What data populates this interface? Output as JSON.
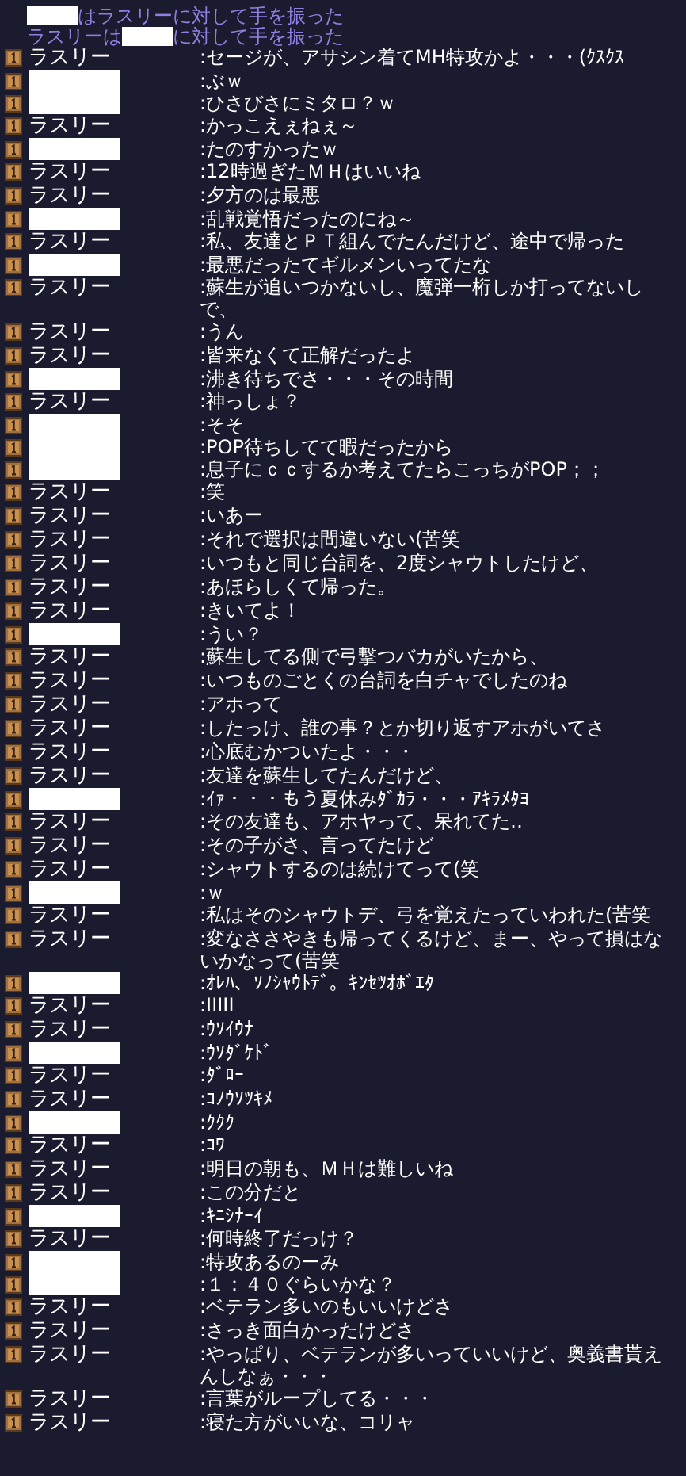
{
  "system_lines": [
    {
      "parts": [
        {
          "kind": "hidden"
        },
        {
          "kind": "text",
          "text": "はラスリーに対して手を振った"
        }
      ]
    },
    {
      "parts": [
        {
          "kind": "text",
          "text": "ラスリーは"
        },
        {
          "kind": "hidden"
        },
        {
          "kind": "text",
          "text": "に対して手を振った"
        }
      ]
    }
  ],
  "messages": [
    {
      "name_hidden": false,
      "name": "ラスリー",
      "text": ":セージが、アサシン着てMH特攻かよ・・・(ｸｽｸｽ"
    },
    {
      "name_hidden": true,
      "text": ":ぶｗ"
    },
    {
      "name_hidden": true,
      "text": ":ひさびさにミタロ？ｗ"
    },
    {
      "name_hidden": false,
      "name": "ラスリー",
      "text": ":かっこえぇねぇ～"
    },
    {
      "name_hidden": true,
      "text": ":たのすかったｗ"
    },
    {
      "name_hidden": false,
      "name": "ラスリー",
      "text": ":12時過ぎたＭＨはいいね"
    },
    {
      "name_hidden": false,
      "name": "ラスリー",
      "text": ":夕方のは最悪"
    },
    {
      "name_hidden": true,
      "text": ":乱戦覚悟だったのにね～"
    },
    {
      "name_hidden": false,
      "name": "ラスリー",
      "text": ":私、友達とＰＴ組んでたんだけど、途中で帰った"
    },
    {
      "name_hidden": true,
      "text": ":最悪だったてギルメンいってたな"
    },
    {
      "name_hidden": false,
      "name": "ラスリー",
      "text": ":蘇生が追いつかないし、魔弾一桁しか打ってないしで、"
    },
    {
      "name_hidden": false,
      "name": "ラスリー",
      "text": ":うん"
    },
    {
      "name_hidden": false,
      "name": "ラスリー",
      "text": ":皆来なくて正解だったよ"
    },
    {
      "name_hidden": true,
      "text": ":沸き待ちでさ・・・その時間"
    },
    {
      "name_hidden": false,
      "name": "ラスリー",
      "text": ":神っしょ？"
    },
    {
      "name_hidden": true,
      "text": ":そそ"
    },
    {
      "name_hidden": true,
      "text": ":POP待ちしてて暇だったから"
    },
    {
      "name_hidden": true,
      "text": ":息子にｃｃするか考えてたらこっちがPOP；；"
    },
    {
      "name_hidden": false,
      "name": "ラスリー",
      "text": ":笑"
    },
    {
      "name_hidden": false,
      "name": "ラスリー",
      "text": ":いあー"
    },
    {
      "name_hidden": false,
      "name": "ラスリー",
      "text": ":それで選択は間違いない(苦笑"
    },
    {
      "name_hidden": false,
      "name": "ラスリー",
      "text": ":いつもと同じ台詞を、2度シャウトしたけど、"
    },
    {
      "name_hidden": false,
      "name": "ラスリー",
      "text": ":あほらしくて帰った。"
    },
    {
      "name_hidden": false,
      "name": "ラスリー",
      "text": ":きいてよ！"
    },
    {
      "name_hidden": true,
      "text": ":うい？"
    },
    {
      "name_hidden": false,
      "name": "ラスリー",
      "text": ":蘇生してる側で弓撃つバカがいたから、"
    },
    {
      "name_hidden": false,
      "name": "ラスリー",
      "text": ":いつものごとくの台詞を白チャでしたのね"
    },
    {
      "name_hidden": false,
      "name": "ラスリー",
      "text": ":アホって"
    },
    {
      "name_hidden": false,
      "name": "ラスリー",
      "text": ":したっけ、誰の事？とか切り返すアホがいてさ"
    },
    {
      "name_hidden": false,
      "name": "ラスリー",
      "text": ":心底むかついたよ・・・"
    },
    {
      "name_hidden": false,
      "name": "ラスリー",
      "text": ":友達を蘇生してたんだけど、"
    },
    {
      "name_hidden": true,
      "text": ":ｲｧ・・・もう夏休みﾀﾞｶﾗ・・・ｱｷﾗﾒﾀﾖ"
    },
    {
      "name_hidden": false,
      "name": "ラスリー",
      "text": ":その友達も、アホヤって、呆れてた‥"
    },
    {
      "name_hidden": false,
      "name": "ラスリー",
      "text": ":その子がさ、言ってたけど"
    },
    {
      "name_hidden": false,
      "name": "ラスリー",
      "text": ":シャウトするのは続けてって(笑"
    },
    {
      "name_hidden": true,
      "text": ":ｗ"
    },
    {
      "name_hidden": false,
      "name": "ラスリー",
      "text": ":私はそのシャウトデ、弓を覚えたっていわれた(苦笑"
    },
    {
      "name_hidden": false,
      "name": "ラスリー",
      "text": ":変なささやきも帰ってくるけど、まー、やって損はないかなって(苦笑"
    },
    {
      "name_hidden": true,
      "text": ":ｵﾚﾊ、ｿﾉｼｬｳﾄﾃﾞ。ｷﾝｾﾂｵﾎﾞｴﾀ"
    },
    {
      "name_hidden": false,
      "name": "ラスリー",
      "text": ":IIIII"
    },
    {
      "name_hidden": false,
      "name": "ラスリー",
      "text": ":ｳｿｲｳﾅ"
    },
    {
      "name_hidden": true,
      "text": ":ｳｿﾀﾞｹﾄﾞ"
    },
    {
      "name_hidden": false,
      "name": "ラスリー",
      "text": ":ﾀﾞﾛｰ"
    },
    {
      "name_hidden": false,
      "name": "ラスリー",
      "text": ":ｺﾉｳｿﾂｷﾒ"
    },
    {
      "name_hidden": true,
      "text": ":ｸｸｸ"
    },
    {
      "name_hidden": false,
      "name": "ラスリー",
      "text": ":ｺﾜ"
    },
    {
      "name_hidden": false,
      "name": "ラスリー",
      "text": ":明日の朝も、ＭＨは難しいね"
    },
    {
      "name_hidden": false,
      "name": "ラスリー",
      "text": ":この分だと"
    },
    {
      "name_hidden": true,
      "text": ":ｷﾆｼﾅｰｲ"
    },
    {
      "name_hidden": false,
      "name": "ラスリー",
      "text": ":何時終了だっけ？"
    },
    {
      "name_hidden": true,
      "text": ":特攻あるのーみ"
    },
    {
      "name_hidden": true,
      "text": ":１：４０ぐらいかな？"
    },
    {
      "name_hidden": false,
      "name": "ラスリー",
      "text": ":ベテラン多いのもいいけどさ"
    },
    {
      "name_hidden": false,
      "name": "ラスリー",
      "text": ":さっき面白かったけどさ"
    },
    {
      "name_hidden": false,
      "name": "ラスリー",
      "text": ":やっぱり、ベテランが多いっていいけど、奥義書貰えんしなぁ・・・"
    },
    {
      "name_hidden": false,
      "name": "ラスリー",
      "text": ":言葉がループしてる・・・"
    },
    {
      "name_hidden": false,
      "name": "ラスリー",
      "text": ":寝た方がいいな、コリャ"
    }
  ]
}
